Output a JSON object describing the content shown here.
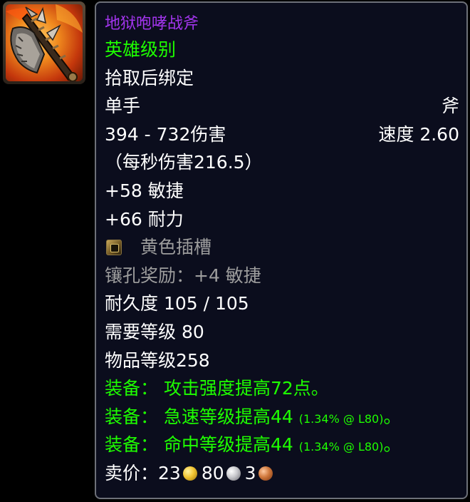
{
  "item": {
    "name": "地狱咆哮战斧",
    "quality": "英雄级别",
    "bind": "拾取后绑定",
    "slot": "单手",
    "type": "斧",
    "damage": "394 - 732伤害",
    "speed": "速度 2.60",
    "dps": "（每秒伤害216.5）",
    "stat_agility": "+58 敏捷",
    "stat_stamina": "+66 耐力",
    "socket": "黄色插槽",
    "socket_bonus": "镶孔奖励：+4 敏捷",
    "durability": "耐久度 105 / 105",
    "required_level": "需要等级 80",
    "item_level": "物品等级258",
    "equip_1": "装备： 攻击强度提高72点。",
    "equip_2_main": "装备： 急速等级提高44",
    "equip_2_detail": "(1.34% @ L80)",
    "equip_2_end": "。",
    "equip_3_main": "装备： 命中等级提高44",
    "equip_3_detail": "(1.34% @ L80)",
    "equip_3_end": "。",
    "sell_label": "卖价：",
    "sell_gold": "23",
    "sell_silver": "80",
    "sell_copper": "3"
  },
  "icons": {
    "item": "axe-icon",
    "socket": "yellow-socket-icon",
    "gold": "gold-coin-icon",
    "silver": "silver-coin-icon",
    "copper": "copper-coin-icon"
  },
  "colors": {
    "epic": "#a335ee",
    "uncommon": "#1eff00",
    "common": "#ffffff",
    "poor": "#9d9d9d",
    "tooltip_bg": "#0b0d1d",
    "tooltip_border": "#6d7078"
  }
}
